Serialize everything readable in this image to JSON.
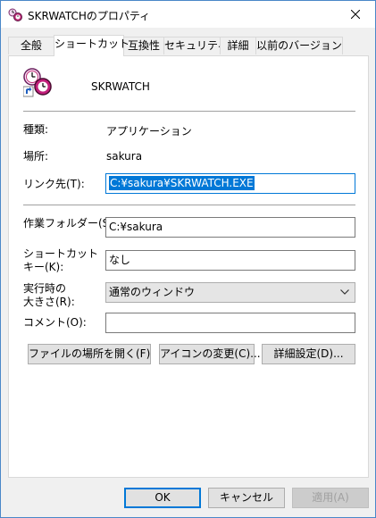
{
  "window": {
    "title": "SKRWATCHのプロパティ",
    "close_label": "close"
  },
  "tabs": [
    {
      "label": "全般"
    },
    {
      "label": "ショートカット"
    },
    {
      "label": "互換性"
    },
    {
      "label": "セキュリティ"
    },
    {
      "label": "詳細"
    },
    {
      "label": "以前のバージョン"
    }
  ],
  "active_tab": 1,
  "app": {
    "name": "SKRWATCH",
    "icon": "clock-shortcut-icon"
  },
  "fields": {
    "type_label": "種類:",
    "type_value": "アプリケーション",
    "location_label": "場所:",
    "location_value": "sakura",
    "target_label": "リンク先(T):",
    "target_value": "C:¥sakura¥SKRWATCH.EXE",
    "workdir_label": "作業フォルダー(S):",
    "workdir_value": "C:¥sakura",
    "shortcut_label_1": "ショートカット",
    "shortcut_label_2": "キー(K):",
    "shortcut_value": "なし",
    "run_label_1": "実行時の",
    "run_label_2": "大きさ(R):",
    "run_value": "通常のウィンドウ",
    "comment_label": "コメント(O):",
    "comment_value": ""
  },
  "action_buttons": {
    "open_location": "ファイルの場所を開く(F)",
    "change_icon": "アイコンの変更(C)...",
    "advanced": "詳細設定(D)..."
  },
  "dialog_buttons": {
    "ok": "OK",
    "cancel": "キャンセル",
    "apply": "適用(A)"
  }
}
